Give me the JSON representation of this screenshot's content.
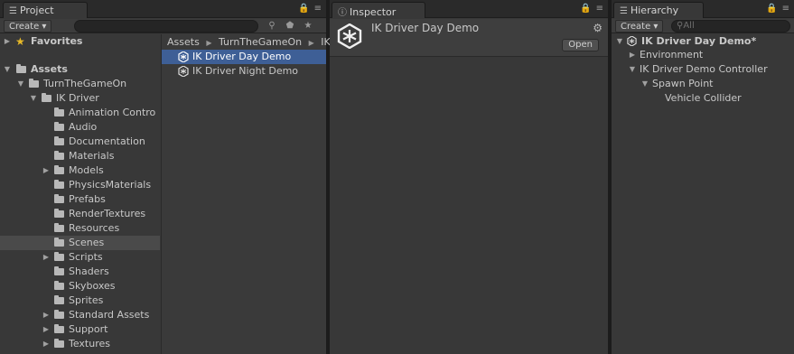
{
  "project": {
    "tab_label": "Project",
    "create_label": "Create",
    "favorites_label": "Favorites",
    "assets_label": "Assets",
    "tree": [
      {
        "label": "TurnTheGameOn",
        "expanded": true
      },
      {
        "label": "IK Driver",
        "expanded": true
      },
      {
        "label": "Animation Contro"
      },
      {
        "label": "Audio"
      },
      {
        "label": "Documentation"
      },
      {
        "label": "Materials"
      },
      {
        "label": "Models",
        "collapsed": true
      },
      {
        "label": "PhysicsMaterials"
      },
      {
        "label": "Prefabs"
      },
      {
        "label": "RenderTextures"
      },
      {
        "label": "Resources"
      },
      {
        "label": "Scenes",
        "selected": true
      },
      {
        "label": "Scripts",
        "collapsed": true
      },
      {
        "label": "Shaders"
      },
      {
        "label": "Skyboxes"
      },
      {
        "label": "Sprites"
      },
      {
        "label": "Standard Assets",
        "collapsed": true
      },
      {
        "label": "Support",
        "collapsed": true
      },
      {
        "label": "Textures",
        "collapsed": true
      }
    ],
    "breadcrumb": [
      "Assets",
      "TurnTheGameOn",
      "IK"
    ],
    "files": [
      {
        "label": "IK Driver Day Demo",
        "selected": true
      },
      {
        "label": "IK Driver Night Demo"
      }
    ]
  },
  "inspector": {
    "tab_label": "Inspector",
    "title": "IK Driver Day Demo",
    "open_label": "Open"
  },
  "hierarchy": {
    "tab_label": "Hierarchy",
    "create_label": "Create",
    "search_placeholder": "All",
    "scene_label": "IK Driver Day Demo*",
    "items": [
      {
        "label": "Environment"
      },
      {
        "label": "IK Driver Demo Controller"
      },
      {
        "label": "Spawn Point"
      },
      {
        "label": "Vehicle Collider"
      }
    ]
  },
  "colors": {
    "panel_bg": "#383838",
    "selection_blue": "#3e5f96",
    "selection_grey": "#4a4a4a"
  }
}
